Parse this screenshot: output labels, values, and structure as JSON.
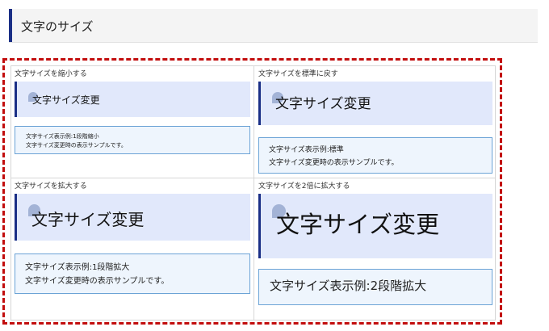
{
  "header": {
    "title": "文字のサイズ"
  },
  "cells": [
    {
      "label": "文字サイズを縮小する",
      "heading": "文字サイズ変更",
      "sample_lines": [
        "文字サイズ表示例:1段階縮小",
        "文字サイズ変更時の表示サンプルです。"
      ]
    },
    {
      "label": "文字サイズを標準に戻す",
      "heading": "文字サイズ変更",
      "sample_lines": [
        "文字サイズ表示例:標準",
        "文字サイズ変更時の表示サンプルです。"
      ]
    },
    {
      "label": "文字サイズを拡大する",
      "heading": "文字サイズ変更",
      "sample_lines": [
        "文字サイズ表示例:1段階拡大",
        "文字サイズ変更時の表示サンプルです。"
      ]
    },
    {
      "label": "文字サイズを2倍に拡大する",
      "heading": "文字サイズ変更",
      "sample_lines": [
        "文字サイズ表示例:2段階拡大"
      ]
    }
  ],
  "colors": {
    "accent": "#1a2f86",
    "highlight_border": "#c20d0d",
    "heading_bg": "#e1e8fb",
    "sample_bg": "#eef5fd",
    "sample_border": "#6ba3d6"
  }
}
